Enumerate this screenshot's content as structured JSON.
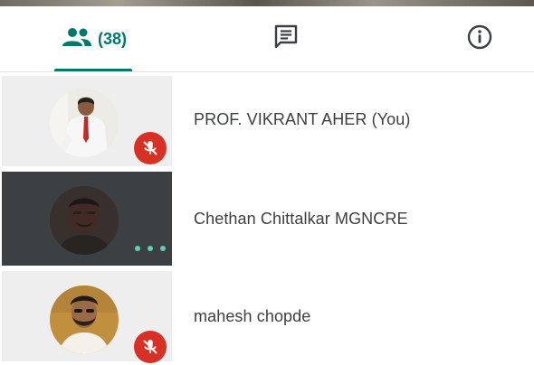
{
  "tabs": {
    "people_count": "(38)"
  },
  "participants": [
    {
      "name": "PROF. VIKRANT AHER (You)",
      "status": "muted"
    },
    {
      "name": "Chethan Chittalkar MGNCRE",
      "status": "more-options"
    },
    {
      "name": "mahesh chopde",
      "status": "muted"
    }
  ],
  "colors": {
    "accent": "#00796b",
    "muted_badge": "#d93025",
    "active_tile": "#3c4043",
    "dots": "#5bd0b4"
  },
  "icons": {
    "people_tab": "people-icon",
    "chat_tab": "chat-icon",
    "info_tab": "info-icon",
    "muted": "mic-off-icon",
    "more": "more-horiz-icon"
  }
}
